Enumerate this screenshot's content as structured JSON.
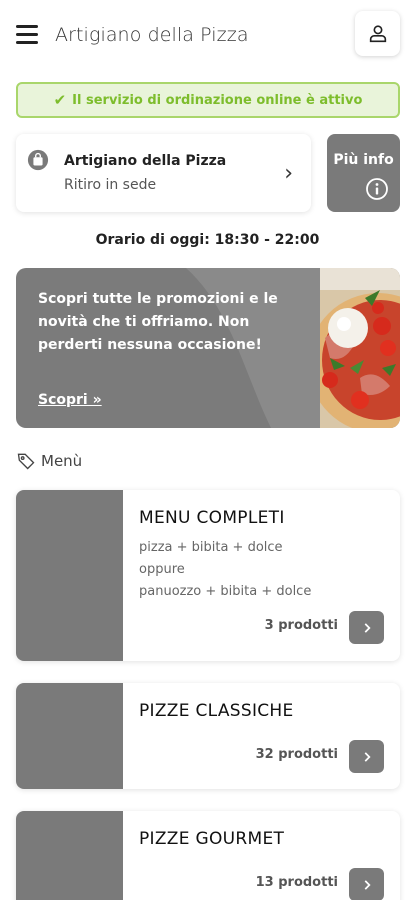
{
  "header": {
    "title": "Artigiano della Pizza",
    "menu_icon": "hamburger-icon",
    "user_icon": "user-icon"
  },
  "status_banner": {
    "text": "Il servizio di ordinazione online è attivo",
    "icon": "check-icon",
    "color": "#7dbd2c"
  },
  "store": {
    "name": "Artigiano della Pizza",
    "mode": "Ritiro in sede",
    "icon": "bag-icon"
  },
  "info_button": {
    "label": "Più info",
    "icon": "info-icon"
  },
  "hours": {
    "text": "Orario di oggi: 18:30 - 22:00"
  },
  "promo": {
    "text": "Scopri tutte le promozioni e le novità che ti offriamo. Non perderti nessuna occasione!",
    "link_label": "Scopri »"
  },
  "menu": {
    "title": "Menù",
    "icon": "tag-icon",
    "categories": [
      {
        "title": "MENU COMPLETI",
        "desc": [
          "pizza + bibita + dolce",
          "oppure",
          "panuozzo + bibita + dolce"
        ],
        "count": "3 prodotti"
      },
      {
        "title": "PIZZE CLASSICHE",
        "count": "32 prodotti"
      },
      {
        "title": "PIZZE GOURMET",
        "count": "13 prodotti"
      }
    ]
  },
  "colors": {
    "accent_green": "#7dbd2c",
    "placeholder_gray": "#7a7a7a"
  }
}
